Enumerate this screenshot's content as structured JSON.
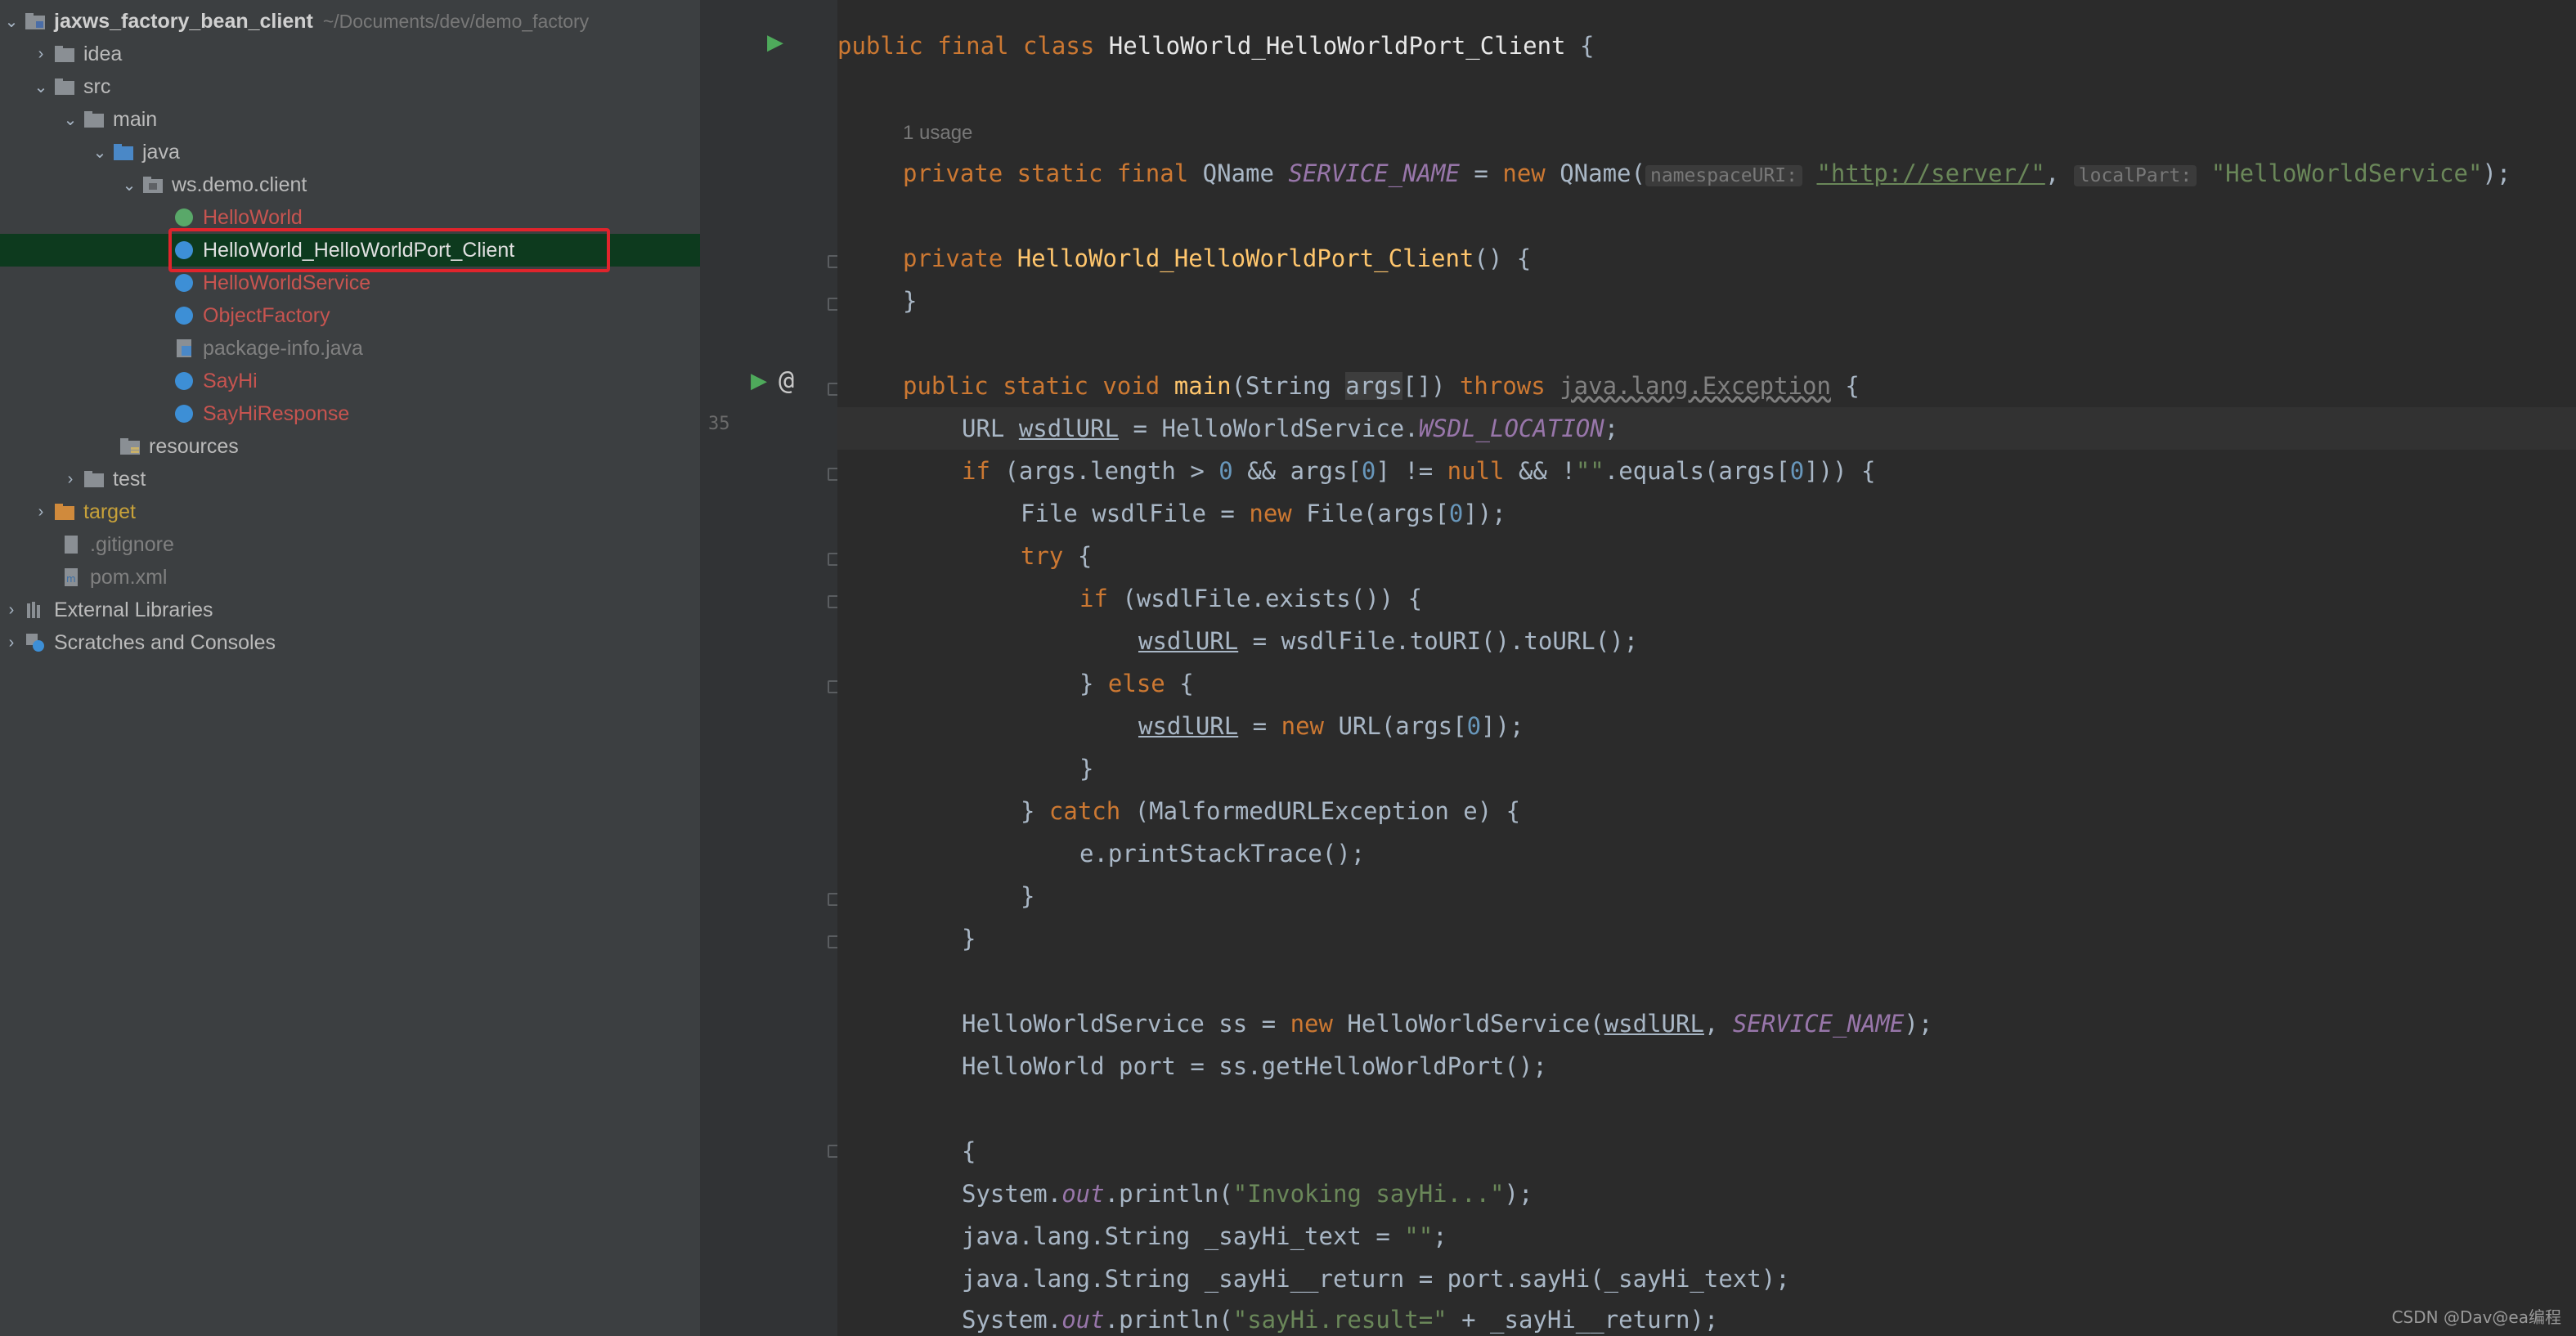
{
  "project": {
    "root_name": "jaxws_factory_bean_client",
    "root_path_hint": "~/Documents/dev/demo_factory",
    "items": [
      {
        "label": "idea"
      },
      {
        "label": "src"
      },
      {
        "label": "main"
      },
      {
        "label": "java"
      },
      {
        "label": "ws.demo.client"
      },
      {
        "label": "HelloWorld"
      },
      {
        "label": "HelloWorld_HelloWorldPort_Client"
      },
      {
        "label": "HelloWorldService"
      },
      {
        "label": "ObjectFactory"
      },
      {
        "label": "package-info.java"
      },
      {
        "label": "SayHi"
      },
      {
        "label": "SayHiResponse"
      },
      {
        "label": "resources"
      },
      {
        "label": "test"
      },
      {
        "label": "target"
      },
      {
        "label": ".gitignore"
      },
      {
        "label": "pom.xml"
      },
      {
        "label": "External Libraries"
      },
      {
        "label": "Scratches and Consoles"
      }
    ]
  },
  "gutter": {
    "line_number": "35"
  },
  "editor": {
    "class_decl": {
      "kw1": "public",
      "kw2": "final",
      "kw3": "class",
      "name": "HelloWorld_HelloWorldPort_Client",
      "brace": " {"
    },
    "usage_hint": "1 usage",
    "field_line": {
      "kw": "private static final",
      "type": "QName",
      "name": "SERVICE_NAME",
      "eq": " = ",
      "new": "new",
      "ctor": "QName(",
      "hint1": "namespaceURI:",
      "str1": "\"http://server/\"",
      "comma": ", ",
      "hint2": "localPart:",
      "str2": "\"HelloWorldService\"",
      "end": ");"
    },
    "ctor_line": {
      "kw": "private",
      "name": "HelloWorld_HelloWorldPort_Client",
      "rest": "() {"
    },
    "ctor_close": "}",
    "main_line": {
      "kw": "public static void",
      "fn": "main",
      "open": "(String ",
      "args": "args",
      "mid": "[]) ",
      "throws": "throws",
      "exc": "java.lang.Exception",
      "end": " {"
    },
    "url_line": {
      "type": "URL ",
      "var": "wsdlURL",
      "eq": " = HelloWorldService.",
      "const": "WSDL_LOCATION",
      "end": ";"
    },
    "if_line": {
      "kw": "if",
      "rest1": " (args.length > ",
      "num": "0",
      "rest2": " && args[",
      "num2": "0",
      "rest3": "] != ",
      "null": "null",
      "rest4": " && !",
      "str": "\"\"",
      "rest5": ".equals(args[",
      "num3": "0",
      "rest6": "])) {"
    },
    "file_line": {
      "pre": "File wsdlFile = ",
      "new": "new",
      "post": " File(args[",
      "num": "0",
      "end": "]);"
    },
    "try_line": {
      "kw": "try",
      "rest": " {"
    },
    "if2_line": {
      "kw": "if",
      "rest": " (wsdlFile.exists()) {"
    },
    "assign1": {
      "var": "wsdlURL",
      "rest": " = wsdlFile.toURI().toURL();"
    },
    "else_line": {
      "pre": "} ",
      "kw": "else",
      "rest": " {"
    },
    "assign2": {
      "var": "wsdlURL",
      "eq": " = ",
      "new": "new",
      "rest": " URL(args[",
      "num": "0",
      "end": "]);"
    },
    "close1": "}",
    "catch_line": {
      "pre": "} ",
      "kw": "catch",
      "rest": " (MalformedURLException e) {"
    },
    "trace_line": "e.printStackTrace();",
    "close2": "}",
    "close3": "}",
    "svc_line": {
      "pre": "HelloWorldService ss = ",
      "new": "new",
      "rest": " HelloWorldService(",
      "var": "wsdlURL",
      "comma": ", ",
      "const": "SERVICE_NAME",
      "end": ");"
    },
    "port_line": "HelloWorld port = ss.getHelloWorldPort();",
    "block_open": "{",
    "print1": {
      "pre": "System.",
      "out": "out",
      "mid": ".println(",
      "str": "\"Invoking sayHi...\"",
      "end": ");"
    },
    "text_line": {
      "pre": "java.lang.String _sayHi_text = ",
      "str": "\"\"",
      "end": ";"
    },
    "ret_line": "java.lang.String _sayHi__return = port.sayHi(_sayHi_text);",
    "print2": {
      "pre": "System.",
      "out": "out",
      "mid": ".println(",
      "str": "\"sayHi.result=\"",
      "end": " + _sayHi__return);"
    }
  },
  "watermark": "CSDN @Dav@ea编程"
}
